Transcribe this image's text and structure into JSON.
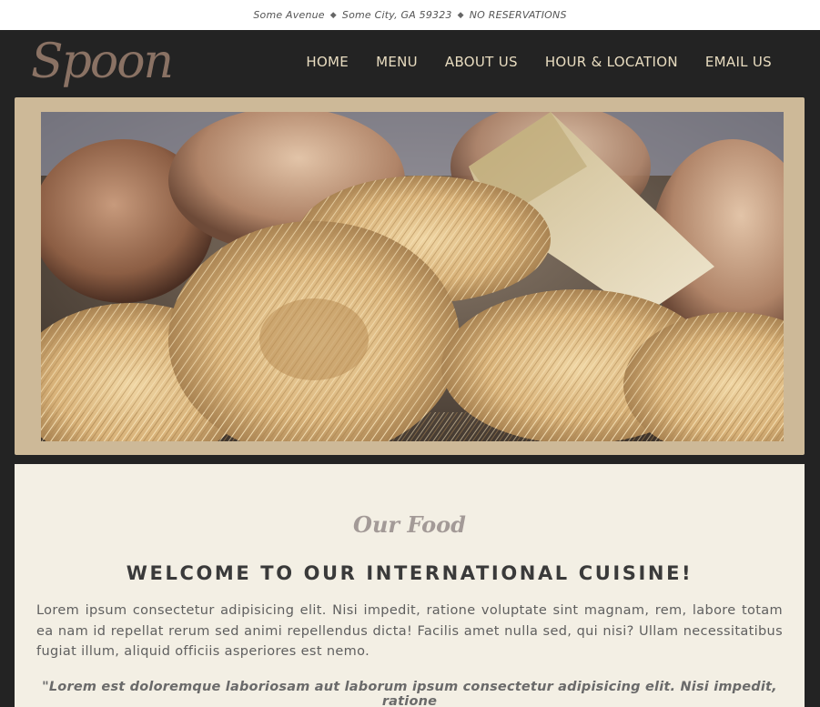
{
  "topbar": {
    "street": "Some Avenue",
    "city": "Some City, GA 59323",
    "note": "NO RESERVATIONS",
    "separator": "◆"
  },
  "header": {
    "logo": "Spoon",
    "nav": [
      "HOME",
      "MENU",
      "ABOUT US",
      "HOUR & LOCATION",
      "EMAIL US"
    ]
  },
  "hero": {
    "image": "pasta-nests-with-onions-and-cheese"
  },
  "main": {
    "section_title": "Our Food",
    "heading": "WELCOME TO OUR INTERNATIONAL CUISINE!",
    "body": "Lorem ipsum consectetur adipisicing elit. Nisi impedit, ratione voluptate sint magnam, rem, labore totam ea nam id repellat rerum sed animi repellendus dicta! Facilis amet nulla sed, qui nisi? Ullam necessitatibus fugiat illum, aliquid officiis asperiores est nemo.",
    "quote": "\"Lorem est doloremque laboriosam aut laborum ipsum consectetur adipisicing elit. Nisi impedit, ratione"
  },
  "colors": {
    "page_bg": "#232323",
    "frame": "#cdb998",
    "nav_text": "#e8dcc0",
    "logo": "#8a7264",
    "content_bg": "#f3efe4"
  }
}
